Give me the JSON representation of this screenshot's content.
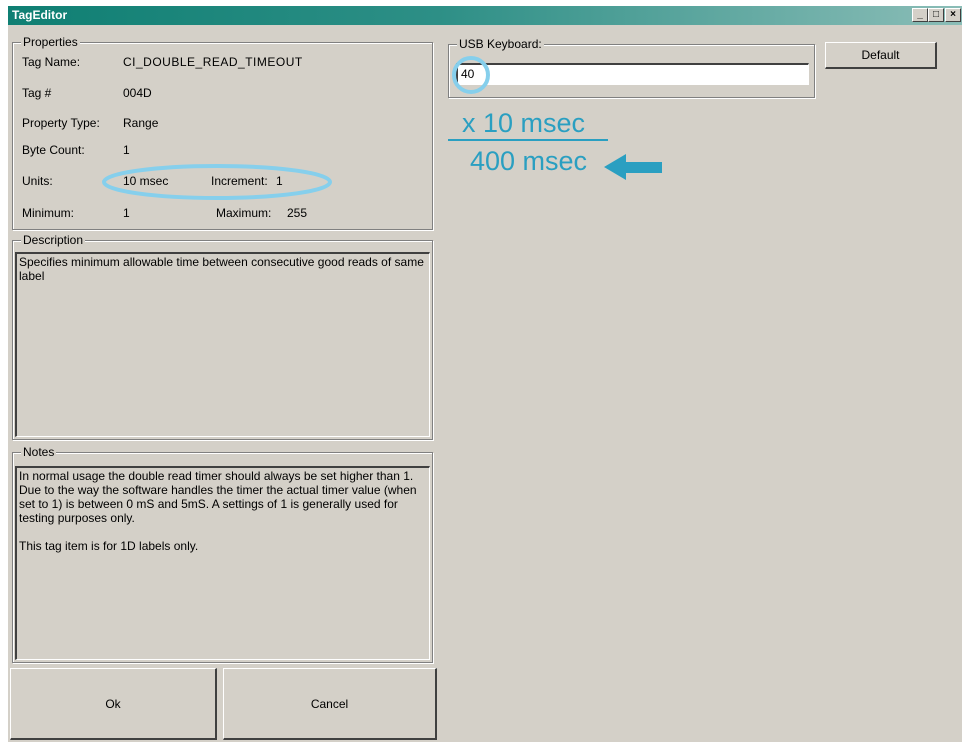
{
  "window": {
    "title": "TagEditor",
    "controls": {
      "minimize": "_",
      "maximize": "□",
      "close": "×"
    }
  },
  "properties": {
    "legend": "Properties",
    "tag_name_label": "Tag Name:",
    "tag_name_value": "CI_DOUBLE_READ_TIMEOUT",
    "tag_num_label": "Tag #",
    "tag_num_value": "004D",
    "property_type_label": "Property Type:",
    "property_type_value": "Range",
    "byte_count_label": "Byte Count:",
    "byte_count_value": "1",
    "units_label": "Units:",
    "units_value": "10 msec",
    "increment_label": "Increment:",
    "increment_value": "1",
    "minimum_label": "Minimum:",
    "minimum_value": "1",
    "maximum_label": "Maximum:",
    "maximum_value": "255"
  },
  "description": {
    "legend": "Description",
    "text": "Specifies minimum allowable time between consecutive good reads of same label"
  },
  "notes": {
    "legend": "Notes",
    "text": "In normal usage the double read timer should always be set higher than 1. Due to the way the software handles the timer the actual timer value (when set to 1) is between 0 mS and 5mS. A settings of 1 is generally used for testing purposes only.\n\nThis tag item is for 1D labels only."
  },
  "usb_keyboard": {
    "legend": "USB Keyboard:",
    "value": "40"
  },
  "buttons": {
    "default": "Default",
    "ok": "Ok",
    "cancel": "Cancel"
  },
  "annotation": {
    "multiplier": "x 10 msec",
    "result": "400 msec",
    "color": "#2a9fc1",
    "highlight_color": "#86cfec"
  }
}
